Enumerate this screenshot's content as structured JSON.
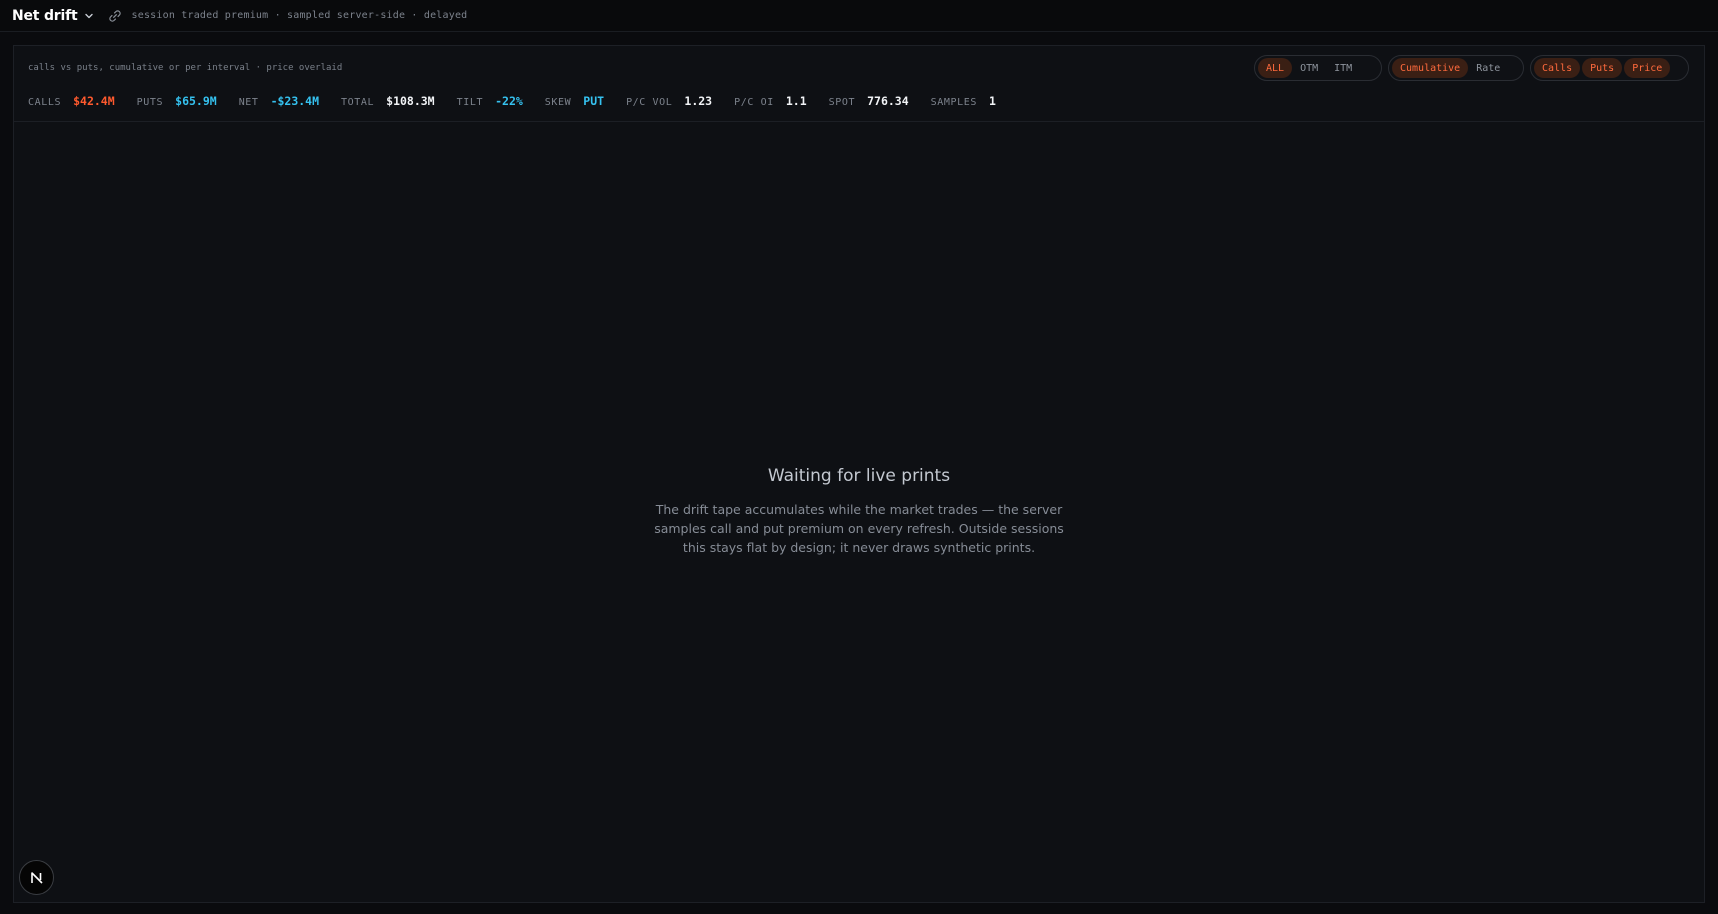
{
  "header": {
    "title": "Net drift",
    "subtitle": "session traded premium · sampled server-side · delayed",
    "icons": [
      "chevron-down-icon",
      "link-icon"
    ]
  },
  "panel": {
    "description": "calls vs puts, cumulative or per interval · price overlaid",
    "stats": [
      {
        "label": "CALLS",
        "value": "$42.4M"
      },
      {
        "label": "PUTS",
        "value": "$65.9M"
      },
      {
        "label": "NET",
        "value": "-$23.4M"
      },
      {
        "label": "TOTAL",
        "value": "$108.3M"
      },
      {
        "label": "TILT",
        "value": "-22%"
      },
      {
        "label": "SKEW",
        "value": "PUT"
      },
      {
        "label": "P/C VOL",
        "value": "1.23"
      },
      {
        "label": "P/C OI",
        "value": "1.1"
      },
      {
        "label": "SPOT",
        "value": "776.34"
      },
      {
        "label": "SAMPLES",
        "value": "1"
      }
    ],
    "filters": {
      "moneyness": {
        "options": [
          "ALL",
          "OTM",
          "ITM"
        ],
        "selected": "ALL"
      },
      "mode": {
        "options": [
          "Cumulative",
          "Rate"
        ],
        "selected": "Cumulative"
      },
      "series": {
        "options": [
          "Calls",
          "Puts",
          "Price"
        ],
        "selected": [
          "Calls",
          "Puts",
          "Price"
        ]
      }
    }
  },
  "empty_state": {
    "title": "Waiting for live prints",
    "body": "The drift tape accumulates while the market trades — the server samples call and put premium on every refresh. Outside sessions this stays flat by design; it never draws synthetic prints."
  },
  "badge": {
    "label": "N"
  },
  "colors": {
    "background": "#0a0b0e",
    "panel": "#0e1014",
    "accent_orange": "#ff5a2e",
    "accent_blue": "#35c2f0",
    "active_pill_bg": "#3a1f14"
  }
}
